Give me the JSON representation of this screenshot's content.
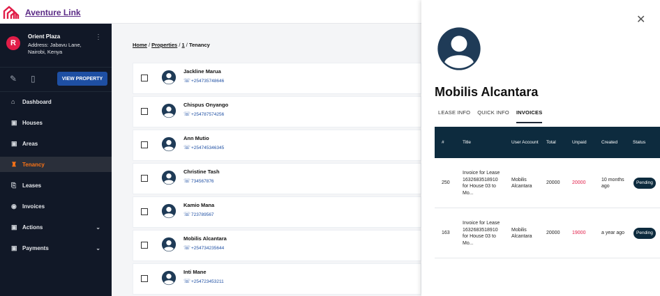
{
  "app": {
    "title": "Aventure Link"
  },
  "sidebar": {
    "org_initial": "R",
    "org_name": "Orient Plaza",
    "org_address": "Address: Jabavu Lane, Nairobi, Kenya",
    "view_button": "VIEW PROPERTY",
    "items": [
      {
        "label": "Dashboard",
        "icon": "home-icon"
      },
      {
        "label": "Houses",
        "icon": "image-icon"
      },
      {
        "label": "Areas",
        "icon": "image-icon"
      },
      {
        "label": "Tenancy",
        "icon": "tenancy-icon",
        "active": true
      },
      {
        "label": "Leases",
        "icon": "copy-icon"
      },
      {
        "label": "Invoices",
        "icon": "dollar-icon"
      },
      {
        "label": "Actions",
        "icon": "image-icon",
        "expandable": true
      },
      {
        "label": "Payments",
        "icon": "image-icon",
        "expandable": true
      }
    ]
  },
  "breadcrumb": {
    "home": "Home",
    "properties": "Properties",
    "id": "1",
    "current": "Tenancy",
    "sep": "/"
  },
  "tenants": [
    {
      "name": "Jackline Marua",
      "phone": "+254735748646"
    },
    {
      "name": "Chispus Onyango",
      "phone": "+254787574256"
    },
    {
      "name": "Ann Mutio",
      "phone": "+254745346345"
    },
    {
      "name": "Christine Tash",
      "phone": "734567876"
    },
    {
      "name": "Kamio Mana",
      "phone": "723789567"
    },
    {
      "name": "Mobilis Alcantara",
      "phone": "+254734235644"
    },
    {
      "name": "Inti Mane",
      "phone": "+254723453211"
    }
  ],
  "panel": {
    "name": "Mobilis Alcantara",
    "tabs": [
      "LEASE INFO",
      "QUICK INFO",
      "INVOICES"
    ],
    "active_tab": "INVOICES",
    "columns": [
      "#",
      "Title",
      "User Account",
      "Total",
      "Unpaid",
      "Created",
      "Status"
    ],
    "invoices": [
      {
        "id": "250",
        "title": "Invoice for Lease 1632683518910 for House 03 to Mo...",
        "account": "Mobilis Alcantara",
        "total": "20000",
        "unpaid": "20000",
        "created": "10 months ago",
        "status": "Pending"
      },
      {
        "id": "163",
        "title": "Invoice for Lease 1632683518910 for House 03 to Mo...",
        "account": "Mobilis Alcantara",
        "total": "20000",
        "unpaid": "19000",
        "created": "a year ago",
        "status": "Pending"
      }
    ]
  },
  "colors": {
    "sidebar_bg": "#111827",
    "accent": "#f97316",
    "primary": "#1e4fa3",
    "table_header": "#0d2b3e",
    "unpaid": "#e11d48"
  }
}
